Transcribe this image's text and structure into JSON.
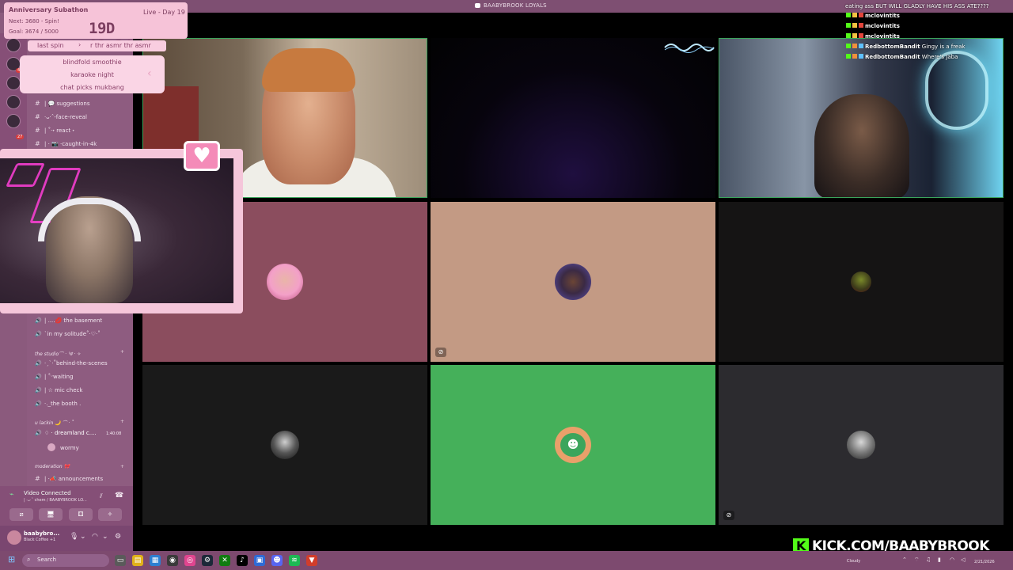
{
  "window": {
    "title": "BAABYBROOK LOYALS"
  },
  "timer": {
    "title": "Anniversary Subathon",
    "status": "Live - Day 19",
    "next": "Next: 3680 - Spin!",
    "goal": "Goal: 3674 / 5000",
    "clock": "19D 02:34:47"
  },
  "spin": {
    "label": "last spin",
    "arrow": "›",
    "ticker": "r thr asmr thr asmr",
    "items": [
      "blindfold smoothie",
      "karaoke night",
      "chat picks mukbang"
    ]
  },
  "sidebar": {
    "guild_badges": [
      "449",
      "27"
    ],
    "channels_top": [
      {
        "icon": "#",
        "label": "|  💬 suggestions"
      },
      {
        "icon": "#",
        "label": "·ᴗ·ˆ-face-reveal"
      },
      {
        "icon": "#",
        "label": "| ˚·˖ react ˖"
      },
      {
        "icon": "#",
        "label": "| · 📷 ·caught-in-4k"
      }
    ],
    "voice_top": [
      {
        "icon": "🔊",
        "label": "| ....💋 the basement"
      },
      {
        "icon": "🔊",
        "label": "ˋin my solitude˚·♡·˚"
      }
    ],
    "cat_studio": "the studio⌒ · ༄ · ✧",
    "studio_channels": [
      {
        "icon": "🔊",
        "label": "·ˏˋ·˚behind-the-scenes"
      },
      {
        "icon": "🔊",
        "label": "| ˚ᵕwaiting"
      },
      {
        "icon": "🔊",
        "label": "| ☆ mic check"
      },
      {
        "icon": "🔊",
        "label": "·._the booth ."
      }
    ],
    "cat_lackin": "u lackin 🌙 ⌒ · ˚",
    "dreamland": {
      "label": "♢ · dreamland c....",
      "time": "1:40:08"
    },
    "member": "wormy",
    "cat_mod": "moderation 🎀",
    "announcements": "| ·📣 announcements"
  },
  "voice": {
    "status": "Video Connected",
    "channel": "| ·ᴗ·ˆ chem / BAABYBROOK LO...",
    "buttons": [
      "⧄",
      "🖥",
      "⚃",
      "✧"
    ]
  },
  "user": {
    "name": "baabybro...",
    "status": "Black Coffee +1"
  },
  "chat": {
    "headline": "eating ass BUT WILL GLADLY HAVE HIS ASS ATE????",
    "lines": [
      {
        "user": "mclovintits",
        "msg": ""
      },
      {
        "user": "mclovintits",
        "msg": ""
      },
      {
        "user": "mclovintits",
        "msg": ""
      },
      {
        "user": "RedbottomBandit",
        "msg": " Gingy is a freak"
      },
      {
        "user": "RedbottomBandit",
        "msg": " Where's Jaba"
      }
    ]
  },
  "kick": {
    "url": "KICK.COM/BAABYBROOK"
  },
  "taskbar": {
    "search_placeholder": "Search",
    "weather": "Cloudy",
    "date": "2/21/2026"
  }
}
